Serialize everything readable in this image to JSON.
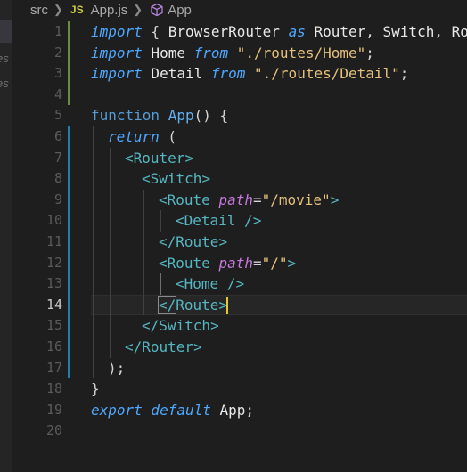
{
  "breadcrumb": {
    "folder": "src",
    "file_badge": "JS",
    "file": "App.js",
    "symbol_icon": "cube-icon",
    "symbol": "App"
  },
  "side_fragments": [
    "es",
    "es"
  ],
  "line_numbers": [
    "1",
    "2",
    "3",
    "4",
    "5",
    "6",
    "7",
    "8",
    "9",
    "10",
    "11",
    "12",
    "13",
    "14",
    "15",
    "16",
    "17",
    "18",
    "19",
    "20"
  ],
  "current_line": 14,
  "code": {
    "l1": {
      "import": "import",
      "open": " { ",
      "a": "BrowserRouter",
      "as": " as ",
      "alias": "Router",
      "comma1": ", ",
      "b": "Switch",
      "comma2": ", ",
      "c": "Ro"
    },
    "l2": {
      "import": "import",
      "name": " Home ",
      "from": "from",
      "str": " \"./routes/Home\"",
      "semi": ";"
    },
    "l3": {
      "import": "import",
      "name": " Detail ",
      "from": "from",
      "str": " \"./routes/Detail\"",
      "semi": ";"
    },
    "l5": {
      "function": "function",
      "name": " App",
      "rest": "() {"
    },
    "l6": {
      "return": "return",
      "rest": " ("
    },
    "l7": {
      "open": "<",
      "tag": "Router",
      "close": ">"
    },
    "l8": {
      "open": "<",
      "tag": "Switch",
      "close": ">"
    },
    "l9": {
      "open": "<",
      "tag": "Route",
      "attr": " path",
      "eq": "=",
      "str": "\"/movie\"",
      "close": ">"
    },
    "l10": {
      "open": "<",
      "tag": "Detail",
      "close": " />"
    },
    "l11": {
      "open": "</",
      "tag": "Route",
      "close": ">"
    },
    "l12": {
      "open": "<",
      "tag": "Route",
      "attr": " path",
      "eq": "=",
      "str": "\"/\"",
      "close": ">"
    },
    "l13": {
      "open": "<",
      "tag": "Home",
      "close": " />"
    },
    "l14": {
      "open": "</",
      "tag": "Route",
      "close": ">"
    },
    "l15": {
      "open": "</",
      "tag": "Switch",
      "close": ">"
    },
    "l16": {
      "open": "</",
      "tag": "Router",
      "close": ">"
    },
    "l17": {
      "text": ");"
    },
    "l18": {
      "text": "}"
    },
    "l19": {
      "export": "export",
      "default": " default",
      "name": " App",
      "semi": ";"
    }
  },
  "colors": {
    "background": "#1e1e1e",
    "keyword": "#4fa8ff",
    "tag": "#56b6c2",
    "attribute": "#c678dd",
    "string": "#e5c07b",
    "cursor": "#e8c531",
    "git_added": "#6a8b47",
    "git_modified": "#1b81a8"
  }
}
